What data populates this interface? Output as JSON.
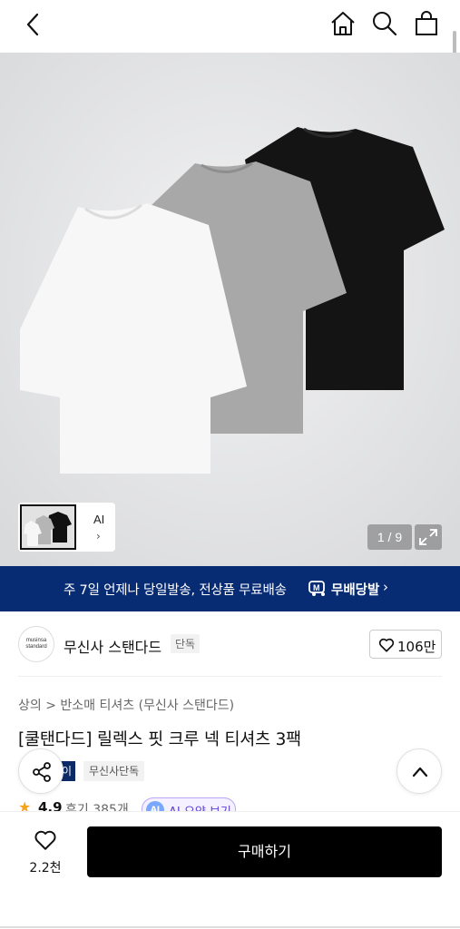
{
  "header": {
    "back_icon": "chevron-left-icon",
    "home_icon": "home-icon",
    "search_icon": "search-icon",
    "bag_icon": "shopping-bag-icon"
  },
  "gallery": {
    "thumb_label": "AI",
    "thumb_arrow": "›",
    "pager": "1 / 9",
    "expand_icon": "expand-icon"
  },
  "banner": {
    "text": "주 7일 언제나 당일발송, 전상품 무료배송",
    "badge": "무배당발",
    "chevron": "›",
    "color": "#072c74"
  },
  "brand": {
    "logo_line1": "musinsa",
    "logo_line2": "standard",
    "name": "무신사 스탠다드",
    "tag": "단독",
    "like_count": "106만"
  },
  "product": {
    "breadcrumb": "상의 > 반소매 티셔츠 (무신사 스탠다드)",
    "title": "[쿨탠다드] 릴렉스 핏 크루 넥 티셔츠 3팩",
    "tag_dark": "이",
    "tag_light": "무신사단독",
    "rating": "4.9",
    "review": "후기 385개",
    "ai_circle": "AI",
    "ai_label": "AI 요약 보기"
  },
  "bottom": {
    "wish_count": "2.2천",
    "buy_label": "구매하기"
  }
}
